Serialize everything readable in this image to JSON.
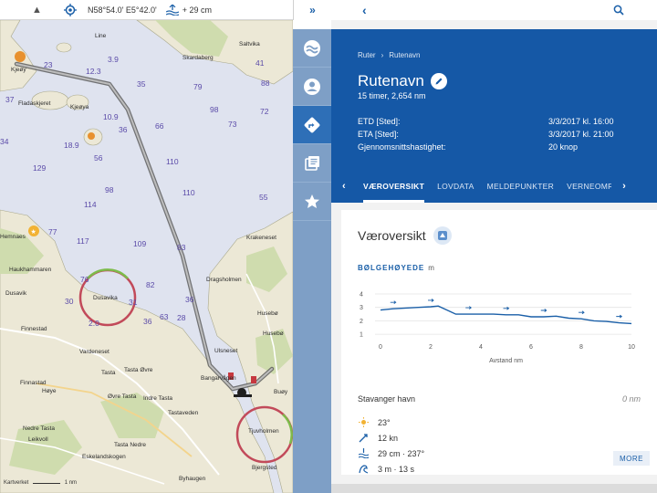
{
  "map": {
    "topbar": {
      "coords": "N58°54.0' E5°42.0'",
      "tide": "+ 29 cm",
      "nav_icon": "navigation-arrow-icon",
      "locate_icon": "crosshair-icon"
    },
    "depths": [
      "23",
      "12.3",
      "3.9",
      "35",
      "41",
      "88",
      "37",
      "79",
      "98",
      "72",
      "10.9",
      "36",
      "66",
      "73",
      "34",
      "18.9",
      "56",
      "110",
      "129",
      "98",
      "55",
      "114",
      "110",
      "77",
      "117",
      "109",
      "83",
      "76",
      "82",
      "36",
      "36",
      "63",
      "28",
      "31",
      "30",
      "2.0"
    ],
    "places": [
      "Line",
      "Kjeøy",
      "Saltvika",
      "Skardaberg",
      "Fladaskjeret",
      "Kjeøya",
      "Hemnaes",
      "Haukhammaren",
      "Dusavik",
      "Dusavika",
      "Finnestad",
      "Vardeneset",
      "Tasta Øvre",
      "Tasta",
      "Indre Tasta",
      "Finnastad",
      "Høye",
      "Øvre Tasta",
      "Tastaveden",
      "Nedre Tasta",
      "Leikvoll",
      "Tasta Nedre",
      "Eskelandskogen",
      "Byhaugen",
      "Krakeneset",
      "Dragsholmen",
      "Husebø",
      "Husebø",
      "Ulsneset",
      "Bangarvågen",
      "Tjuvholmen",
      "Bjergsted",
      "Buøy"
    ],
    "scale": "1 nm",
    "attribution": "Kartverket"
  },
  "rail": {
    "collapse_label": "»",
    "items": [
      {
        "name": "waves",
        "icon": "waves-icon"
      },
      {
        "name": "profile",
        "icon": "person-icon"
      },
      {
        "name": "route",
        "icon": "route-icon"
      },
      {
        "name": "library",
        "icon": "library-icon"
      },
      {
        "name": "favorites",
        "icon": "star-icon"
      }
    ]
  },
  "panel": {
    "back_label": "‹",
    "breadcrumb": [
      "Ruter",
      "›",
      "Rutenavn"
    ],
    "title": "Rutenavn",
    "subtitle": "15 timer, 2,654 nm",
    "info": [
      {
        "label": "ETD [Sted]:",
        "value": "3/3/2017 kl. 16:00"
      },
      {
        "label": "ETA [Sted]:",
        "value": "3/3/2017 kl. 21:00"
      },
      {
        "label": "Gjennomsnittshastighet:",
        "value": "20 knop"
      }
    ],
    "tabs": [
      "VÆROVERSIKT",
      "LOVDATA",
      "MELDEPUNKTER",
      "VERNEOMRÅDER"
    ],
    "active_tab": 0,
    "card": {
      "title": "Væroversikt",
      "wave_label": "BØLGEHØYEDE",
      "wave_unit": "m",
      "station": "Stavanger havn",
      "station_distance": "0 nm",
      "weather": [
        {
          "icon": "sun-icon",
          "value": "23°"
        },
        {
          "icon": "wind-icon",
          "value": "12 kn"
        },
        {
          "icon": "tide-icon",
          "value": "29 cm  ·  237°"
        },
        {
          "icon": "wave-icon",
          "value": "3 m · 13 s"
        }
      ],
      "more_label": "MORE"
    }
  },
  "chart_data": {
    "type": "line",
    "x": [
      0,
      0.5,
      1,
      1.5,
      2,
      2.3,
      3,
      3.5,
      4,
      4.5,
      5,
      5.5,
      6,
      6.5,
      7,
      7.5,
      8,
      8.5,
      9,
      9.5,
      10
    ],
    "series": [
      {
        "values": [
          2.8,
          2.9,
          2.95,
          3.0,
          3.05,
          3.1,
          2.5,
          2.5,
          2.5,
          2.5,
          2.45,
          2.45,
          2.3,
          2.3,
          2.35,
          2.2,
          2.15,
          2.0,
          1.95,
          1.85,
          1.8
        ]
      }
    ],
    "xlabel": "Avstand nm",
    "ylabel": "",
    "xticks": [
      0,
      2,
      4,
      6,
      8,
      10
    ],
    "yticks": [
      1,
      2,
      3,
      4
    ],
    "xlim": [
      0,
      10
    ],
    "ylim": [
      0.6,
      4
    ],
    "direction_arrows": [
      0.5,
      2,
      3.5,
      5,
      6.5,
      8,
      9.5
    ],
    "grid": true,
    "color": "#1a5fa8"
  }
}
